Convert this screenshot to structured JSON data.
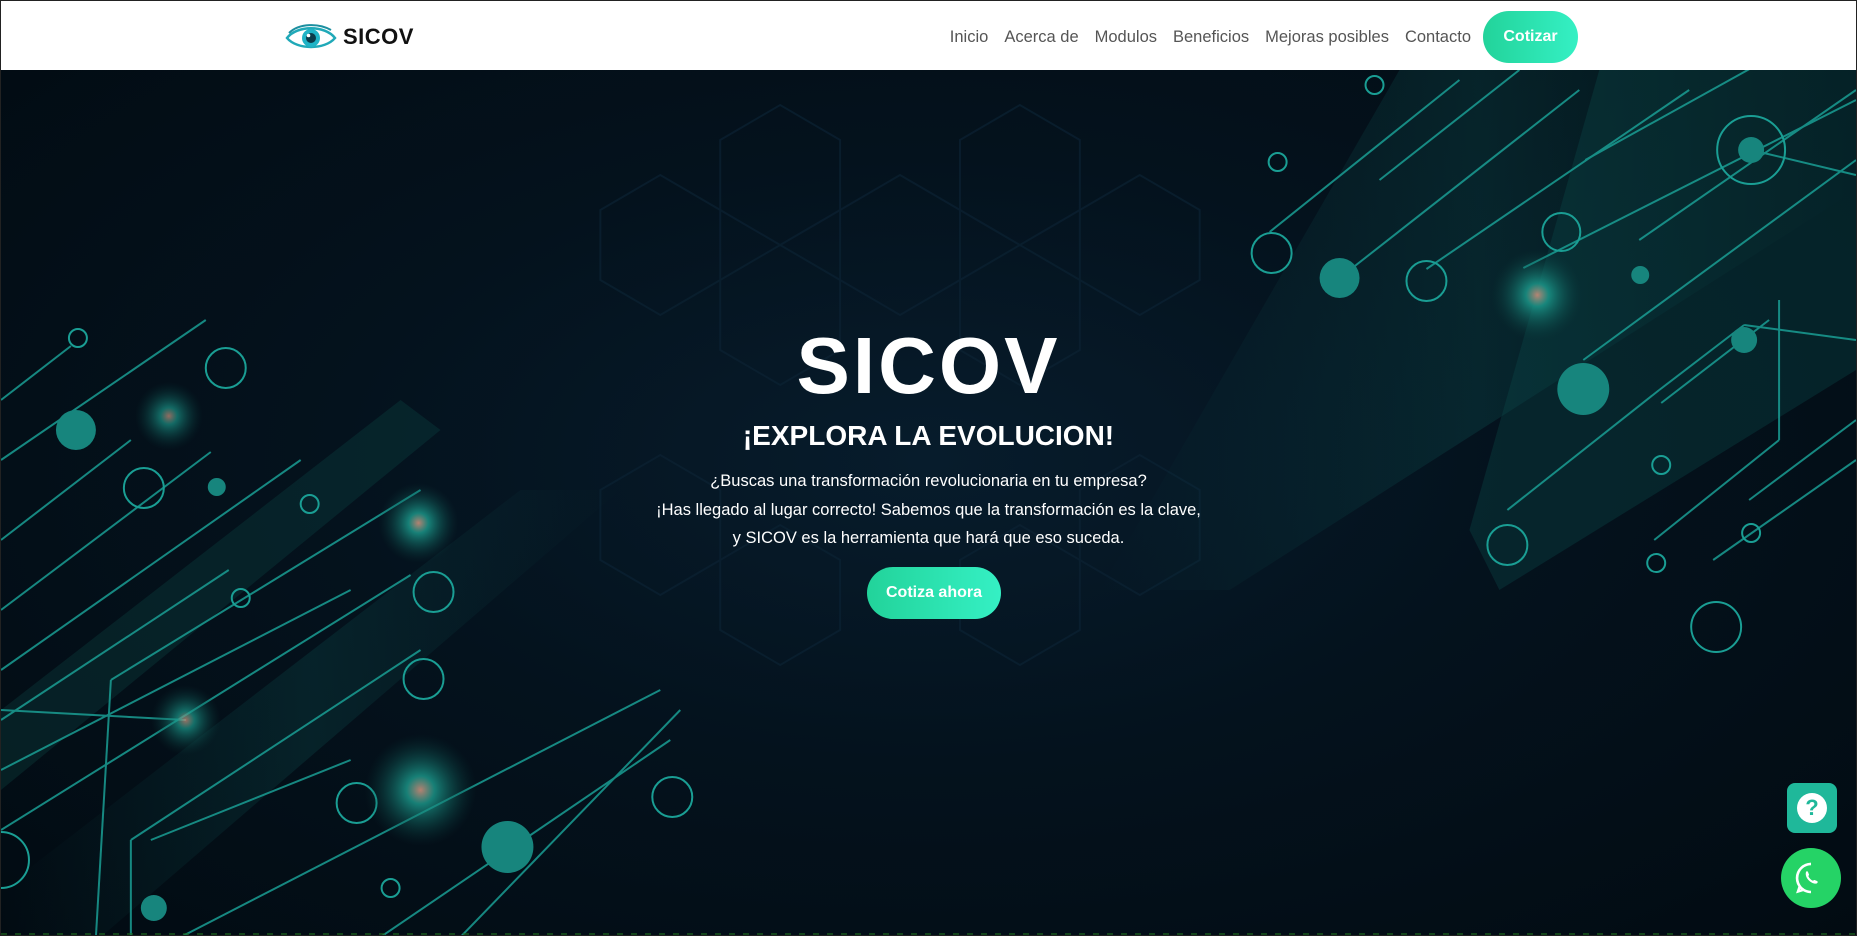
{
  "header": {
    "brand_name": "SICOV",
    "nav": [
      "Inicio",
      "Acerca de",
      "Modulos",
      "Beneficios",
      "Mejoras posibles",
      "Contacto"
    ],
    "cta_label": "Cotizar"
  },
  "hero": {
    "title": "SICOV",
    "subtitle": "¡EXPLORA LA EVOLUCION!",
    "lines": [
      "¿Buscas una transformación revolucionaria en tu empresa?",
      "¡Has llegado al lugar correcto! Sabemos que la transformación es la clave,",
      "y SICOV es la herramienta que hará que eso suceda."
    ],
    "cta_label": "Cotiza ahora"
  },
  "floating": {
    "help_icon": "question-icon",
    "help_glyph": "?",
    "whatsapp_icon": "whatsapp-icon"
  },
  "colors": {
    "accent_start": "#22d39a",
    "accent_end": "#35f0c4",
    "hero_bg": "#04121d",
    "circuit": "#1aa39a",
    "whatsapp": "#25d366"
  }
}
